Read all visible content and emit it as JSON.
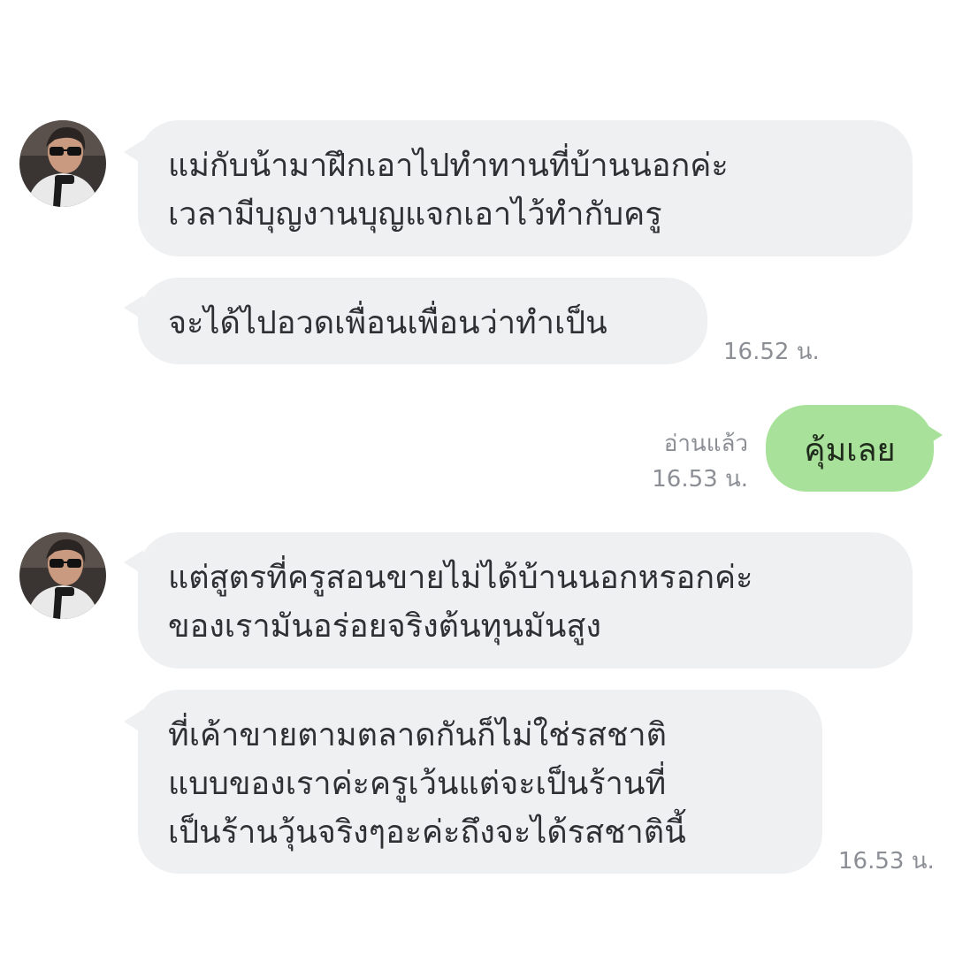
{
  "messages": [
    {
      "lines": [
        "แม่กับน้ามาฝึกเอาไปทำทานที่บ้านนอกค่ะ",
        "เวลามีบุญงานบุญแจกเอาไว้ทำกับครู"
      ]
    },
    {
      "lines": [
        "จะได้ไปอวดเพื่อนเพื่อนว่าทำเป็น"
      ],
      "time": "16.52 น."
    },
    {
      "text": "คุ้มเลย",
      "read_status": "อ่านแล้ว",
      "time": "16.53 น."
    },
    {
      "lines": [
        "แต่สูตรที่ครูสอนขายไม่ได้บ้านนอกหรอกค่ะ",
        "ของเรามันอร่อยจริงต้นทุนมันสูง"
      ]
    },
    {
      "lines": [
        "ที่เค้าขายตามตลาดกันก็ไม่ใช่รสชาติ",
        "แบบของเราค่ะครูเว้นแต่จะเป็นร้านที่",
        "เป็นร้านวุ้นจริงๆอะค่ะถึงจะได้รสชาตินี้"
      ],
      "time": "16.53 น."
    }
  ],
  "colors": {
    "incoming_bubble": "#eff0f2",
    "outgoing_bubble": "#a8e29a",
    "meta_text": "#8b8e94"
  },
  "icons": {
    "avatar": "user-avatar-photo"
  }
}
